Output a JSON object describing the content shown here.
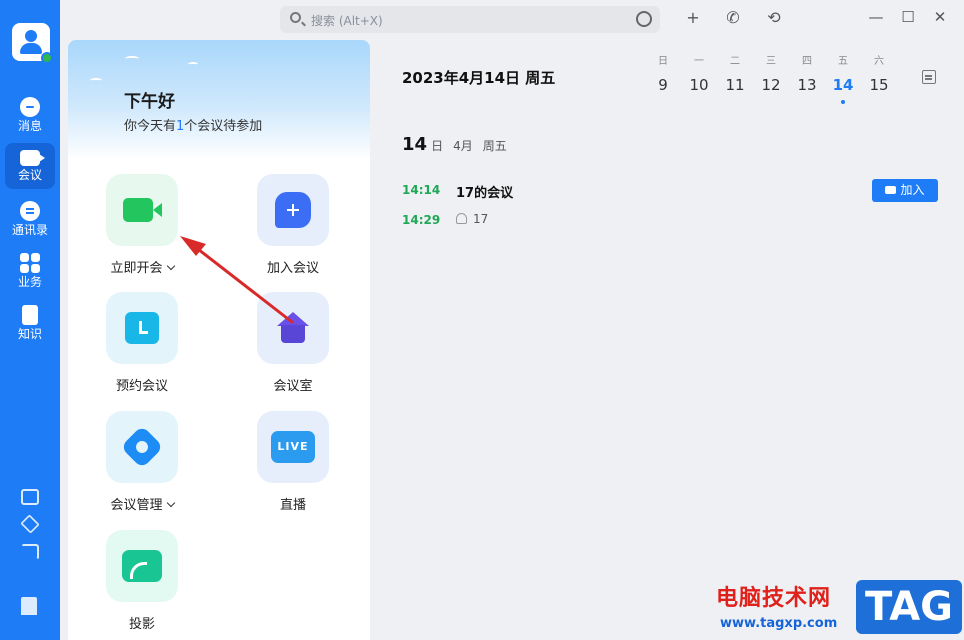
{
  "rail": {
    "items": [
      {
        "label": "消息",
        "icon": "message-icon"
      },
      {
        "label": "会议",
        "icon": "video-meeting-icon"
      },
      {
        "label": "通讯录",
        "icon": "contacts-icon"
      },
      {
        "label": "业务",
        "icon": "apps-grid-icon"
      },
      {
        "label": "知识",
        "icon": "knowledge-book-icon"
      }
    ],
    "bottom_icons": [
      "calendar-icon",
      "cube-icon",
      "cast-icon",
      "building-icon"
    ]
  },
  "search": {
    "placeholder": "搜索 (Alt+X)"
  },
  "toolbar": {
    "add": "+",
    "call": "✆",
    "history": "⟲"
  },
  "window": {
    "minimize": "—",
    "maximize": "☐",
    "close": "✕"
  },
  "greeting": {
    "title": "下午好",
    "sub_pre": "你今天有",
    "sub_num": "1",
    "sub_post": "个会议待参加"
  },
  "actions": {
    "start": "立即开会",
    "join": "加入会议",
    "schedule": "预约会议",
    "room": "会议室",
    "manage": "会议管理",
    "live": "直播",
    "live_badge": "LIVE",
    "cast": "投影"
  },
  "calendar": {
    "date_title": "2023年4月14日 周五",
    "week": [
      {
        "wd": "日",
        "dn": "9"
      },
      {
        "wd": "一",
        "dn": "10"
      },
      {
        "wd": "二",
        "dn": "11"
      },
      {
        "wd": "三",
        "dn": "12"
      },
      {
        "wd": "四",
        "dn": "13"
      },
      {
        "wd": "五",
        "dn": "14"
      },
      {
        "wd": "六",
        "dn": "15"
      }
    ],
    "selected_index": 5,
    "day_num": "14",
    "day_unit": "日",
    "month": "4月",
    "weekday": "周五"
  },
  "event": {
    "start": "14:14",
    "end": "14:29",
    "title": "17的会议",
    "participant": "17",
    "join_label": "加入"
  },
  "watermark": {
    "cn": "电脑技术网",
    "url": "www.tagxp.com",
    "tag": "TAG"
  },
  "colors": {
    "accent": "#1e7cf7",
    "green": "#1fa855",
    "arrow": "#d92a2a"
  }
}
